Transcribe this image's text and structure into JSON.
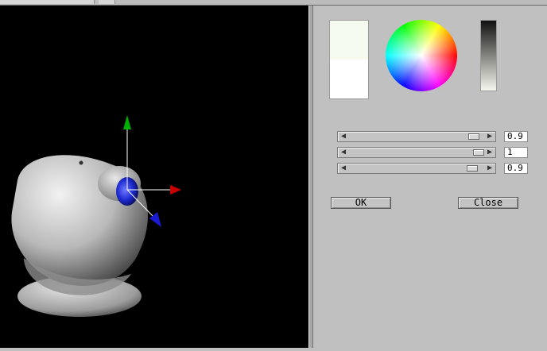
{
  "colors": {
    "panel_bg": "#c0c0c0",
    "viewport_bg": "#000000",
    "new_color": "#f6fbef",
    "old_color": "#ffffff",
    "axis_x": "#c80000",
    "axis_y": "#00b000",
    "axis_z": "#1a1ad0"
  },
  "viewport": {
    "objects": [
      "head-model",
      "eye-sphere",
      "axis-gizmo"
    ]
  },
  "color_editor": {
    "sliders": [
      {
        "name": "slider-1",
        "value_text": "0.9",
        "level": 0.9
      },
      {
        "name": "slider-2",
        "value_text": "1",
        "level": 0.95
      },
      {
        "name": "slider-3",
        "value_text": "0.9",
        "level": 0.88
      }
    ],
    "ok_label": "OK",
    "close_label": "Close"
  }
}
